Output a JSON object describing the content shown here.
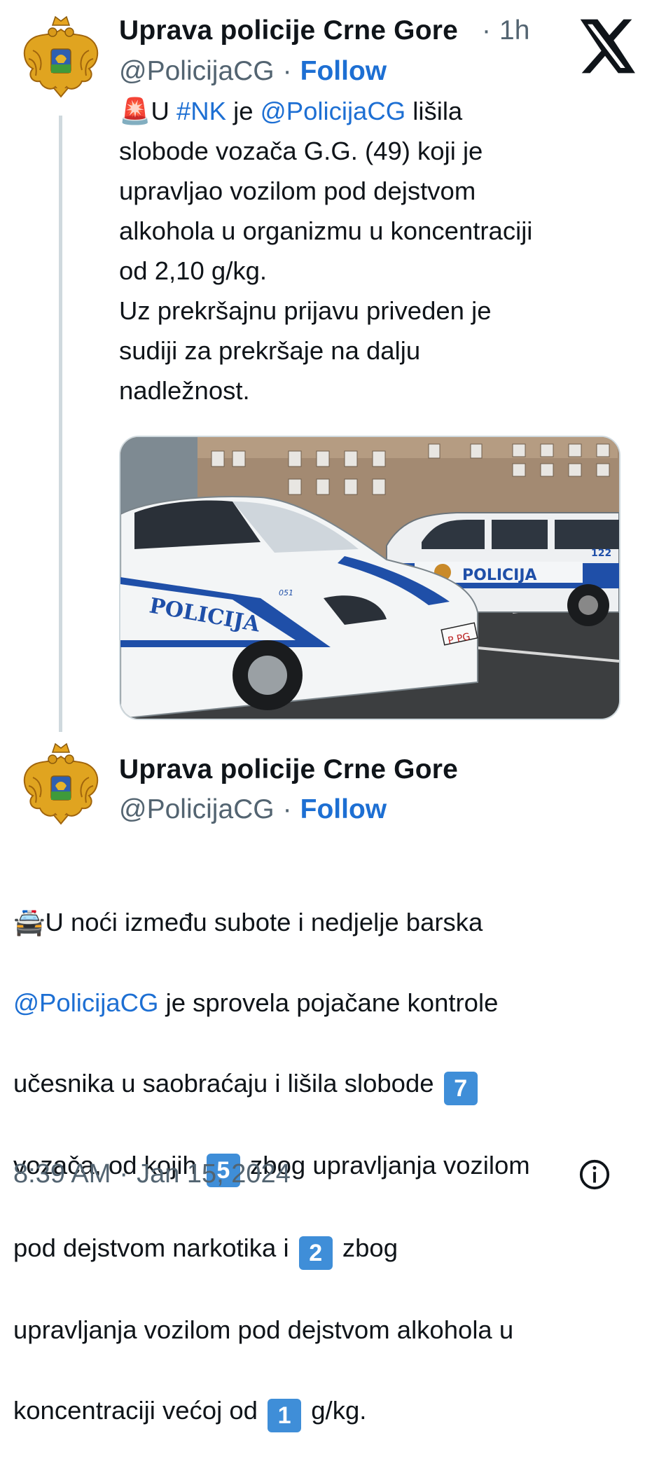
{
  "tweet1": {
    "author_name": "Uprava policije Crne Gore",
    "time": "1h",
    "handle": "@PolicijaCG",
    "follow": "Follow",
    "text": {
      "emoji": "🚨",
      "p1": "U ",
      "hashtag": "#NK",
      "p2": " je ",
      "mention": "@PolicijaCG",
      "p3": " lišila\nslobode vozača G.G. (49) koji je\nupravljao vozilom pod dejstvom\nalkohola u organizmu u koncentraciji\nod 2,10 g/kg.\nUz prekršajnu prijavu priveden je\nsudiji za prekršaje na dalju\nnadležnost."
    },
    "image": {
      "car_text": "POLICIJA",
      "van_text": "POLICIJA",
      "van_number": "122",
      "car_number": "051",
      "plate": "P PG"
    }
  },
  "tweet2": {
    "author_name": "Uprava policije Crne Gore",
    "handle": "@PolicijaCG",
    "follow": "Follow",
    "text": {
      "emoji": "🚔",
      "p1": "U noći između subote i nedjelje barska",
      "mention": "@PolicijaCG",
      "p2": " je sprovela pojačane kontrole",
      "p3": "učesnika u saobraćaju i lišila slobode ",
      "n1": "7",
      "p4": "vozača, od kojih ",
      "n2": "5",
      "p5": " zbog upravljanja vozilom",
      "p6": "pod dejstvom narkotika i ",
      "n3": "2",
      "p7": " zbog",
      "p8": "upravljanja vozilom pod dejstvom alkohola u",
      "p9": "koncentraciji većoj od ",
      "n4": "1",
      "p10": " g/kg."
    },
    "timestamp": "8:39 AM",
    "date": "Jan 15, 2024"
  },
  "icons": {
    "x_logo": "x-logo-icon",
    "info": "info-icon",
    "avatar": "montenegro-coat-of-arms"
  },
  "colors": {
    "link": "#1d6fd3",
    "secondary": "#536471",
    "keycap": "#3f8ed8"
  }
}
